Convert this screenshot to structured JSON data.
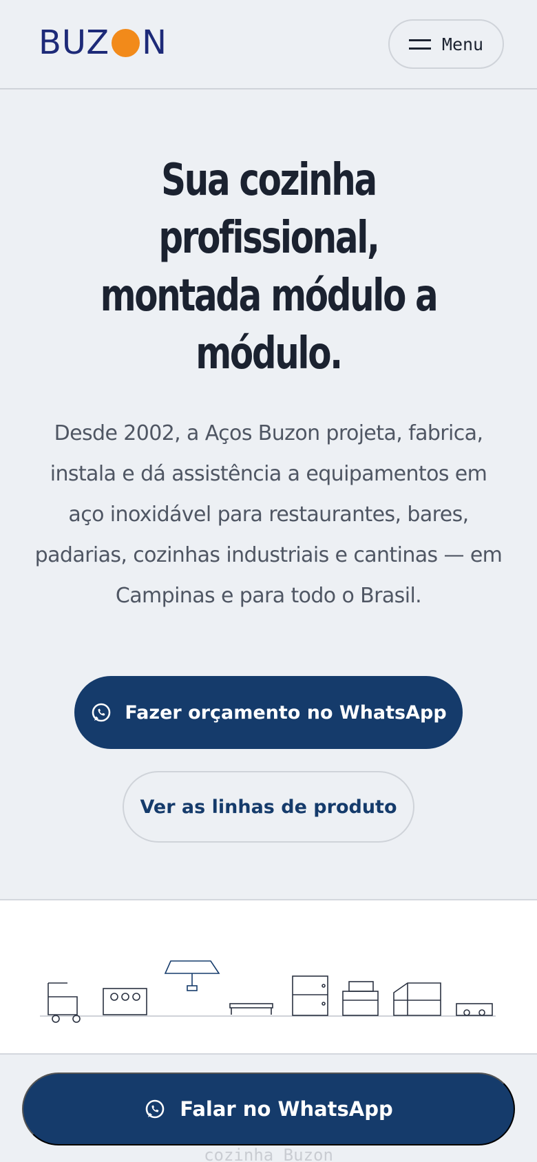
{
  "header": {
    "logo_left": "BUZ",
    "logo_right": "N",
    "menu_label": "Menu"
  },
  "hero": {
    "title": "Sua cozinha profissional, montada módulo a módulo.",
    "description": "Desde 2002, a Aços Buzon projeta, fabrica, instala e dá assistência a equipamentos em aço inoxidável para restaurantes, bares, padarias, cozinhas industriais e cantinas — em Campinas e para todo o Brasil.",
    "primary_cta": "Fazer orçamento no WhatsApp",
    "secondary_cta": "Ver as linhas de produto"
  },
  "floating_cta": {
    "label": "Falar no WhatsApp"
  },
  "peek_text": "cozinha Buzon",
  "colors": {
    "background": "#edf0f4",
    "brand_navy": "#153b6b",
    "logo_blue": "#1d2a78",
    "logo_orange": "#f28a1a"
  },
  "icons": [
    "menu-icon",
    "whatsapp-icon"
  ]
}
